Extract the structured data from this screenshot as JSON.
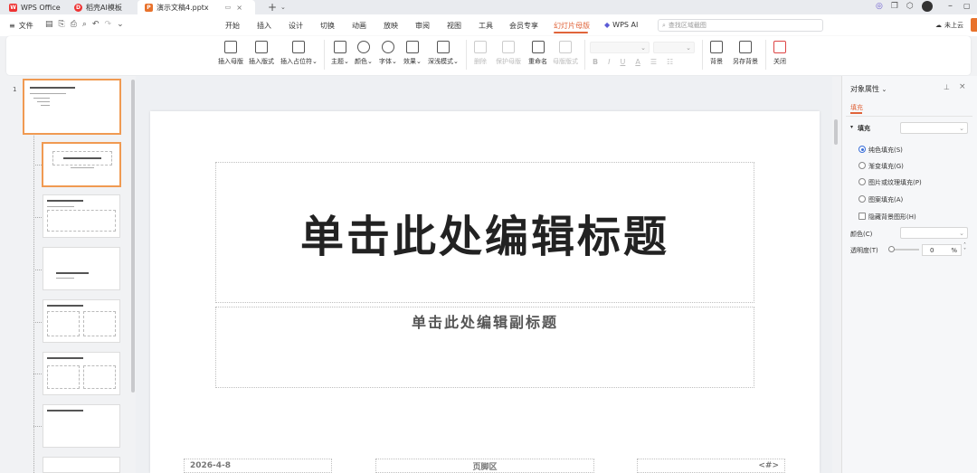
{
  "titlebar": {
    "tabs": [
      {
        "label": "WPS Office",
        "icon": "wps-logo-icon"
      },
      {
        "label": "稻壳AI模板",
        "icon": "docer-logo-icon"
      },
      {
        "label": "演示文稿4.pptx",
        "icon": "presentation-file-icon"
      }
    ],
    "cloud_label": "未上云"
  },
  "menu": {
    "file_label": "文件",
    "items": [
      "开始",
      "插入",
      "设计",
      "切换",
      "动画",
      "放映",
      "审阅",
      "视图",
      "工具",
      "会员专享",
      "幻灯片母版",
      "WPS AI"
    ],
    "active": "幻灯片母版",
    "search_placeholder": "查找区域截图"
  },
  "ribbon": {
    "insert_master": "插入母版",
    "insert_layout": "插入版式",
    "insert_placeholder": "插入占位符",
    "theme": "主题",
    "color": "颜色",
    "font": "字体",
    "effect": "效果",
    "light_dark": "深浅模式",
    "delete": "删除",
    "preserve_master": "保护母版",
    "rename": "重命名",
    "master_layout": "母版版式",
    "bold": "B",
    "italic": "I",
    "underline": "U",
    "font_color": "A",
    "background": "背景",
    "save_background": "另存背景",
    "close": "关闭"
  },
  "slides": {
    "number": "1",
    "thumb_title": "单击此处编辑母版标题样式",
    "thumb_subtitle": "单击此处编辑副标题",
    "thumb_title_2": "单击此处编辑标题"
  },
  "slide": {
    "title": "单击此处编辑标题",
    "subtitle": "单击此处编辑副标题",
    "date": "2026-4-8",
    "footer": "页脚区",
    "page_num": "<#>"
  },
  "properties": {
    "title": "对象属性",
    "tab": "填充",
    "fill_label": "填充",
    "options": [
      "纯色填充(S)",
      "渐变填充(G)",
      "图片或纹理填充(P)",
      "图案填充(A)"
    ],
    "selected_option": "纯色填充(S)",
    "hide_bg_graphics": "隐藏背景图形(H)",
    "color_label": "颜色(C)",
    "transparency_label": "透明度(T)",
    "transparency_value": "0",
    "percent": "%"
  },
  "colors": {
    "accent": "#e0643a",
    "selection": "#f09a52",
    "radio": "#3b6fd8"
  }
}
